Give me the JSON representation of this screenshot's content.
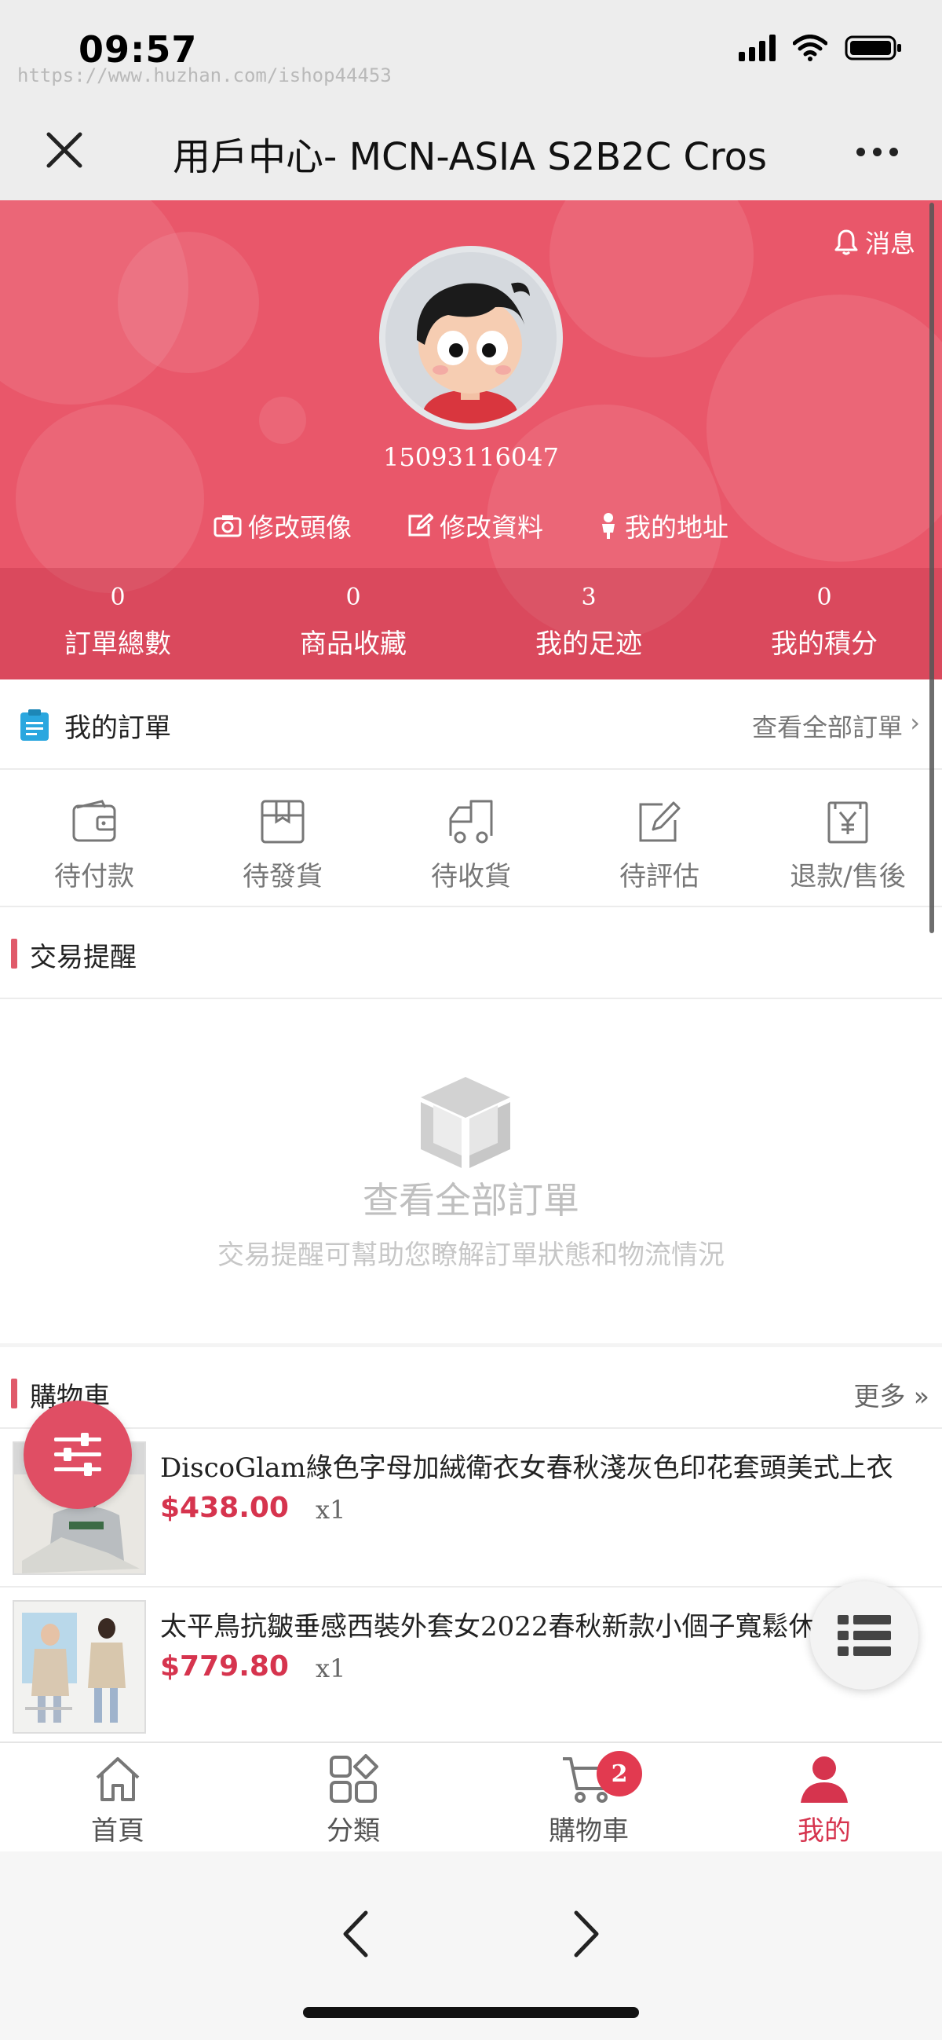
{
  "status_bar": {
    "time": "09:57",
    "watermark": "https://www.huzhan.com/ishop44453"
  },
  "nav": {
    "title": "用戶中心- MCN-ASIA S2B2C Cros"
  },
  "profile": {
    "message_label": "消息",
    "phone": "15093116047",
    "actions": [
      {
        "label": "修改頭像",
        "icon": "camera-icon"
      },
      {
        "label": "修改資料",
        "icon": "edit-icon"
      },
      {
        "label": "我的地址",
        "icon": "person-icon"
      }
    ],
    "stats": [
      {
        "value": "0",
        "label": "訂單總數"
      },
      {
        "value": "0",
        "label": "商品收藏"
      },
      {
        "value": "3",
        "label": "我的足迹"
      },
      {
        "value": "0",
        "label": "我的積分"
      }
    ]
  },
  "orders": {
    "title": "我的訂單",
    "view_all": "查看全部訂單",
    "chevron": "›",
    "items": [
      {
        "label": "待付款",
        "icon": "wallet-icon"
      },
      {
        "label": "待發貨",
        "icon": "box-icon"
      },
      {
        "label": "待收貨",
        "icon": "truck-icon"
      },
      {
        "label": "待評估",
        "icon": "review-icon"
      },
      {
        "label": "退款/售後",
        "icon": "refund-icon"
      }
    ]
  },
  "trade": {
    "title": "交易提醒",
    "empty_title": "查看全部訂單",
    "empty_desc": "交易提醒可幫助您瞭解訂單狀態和物流情況"
  },
  "cart": {
    "title": "購物車",
    "more": "更多 »",
    "items": [
      {
        "title": "DiscoGlam綠色字母加絨衛衣女春秋淺灰色印花套頭美式上衣",
        "price": "$438.00",
        "qty": "x1"
      },
      {
        "title": "太平鳥抗皺垂感西裝外套女2022春秋新款小個子寬鬆休閒西...",
        "price": "$779.80",
        "qty": "x1"
      }
    ]
  },
  "tabbar": {
    "tabs": [
      {
        "label": "首頁",
        "icon": "home-icon"
      },
      {
        "label": "分類",
        "icon": "category-icon"
      },
      {
        "label": "購物車",
        "icon": "cart-icon",
        "badge": "2"
      },
      {
        "label": "我的",
        "icon": "user-icon",
        "active": true
      }
    ]
  },
  "colors": {
    "accent": "#e9576a",
    "price": "#d6344e",
    "badge": "#e23a50"
  }
}
